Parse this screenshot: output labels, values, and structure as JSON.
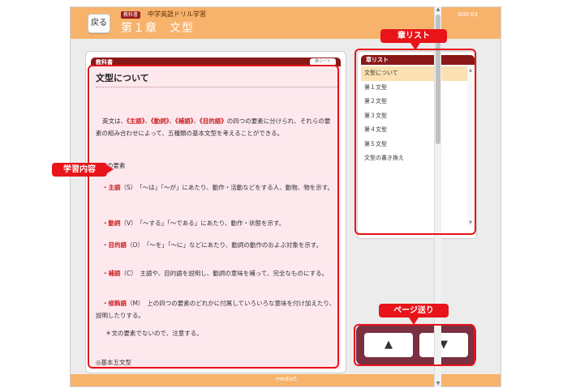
{
  "header": {
    "back_label": "戻る",
    "textbook_badge": "教科書",
    "app_name": "中学英語ドリル学習",
    "chapter_title": "第１章　文型",
    "timer": "000:03"
  },
  "textbook": {
    "panel_title": "教科書",
    "red_sheet_label": "赤シート",
    "section_title": "文型について",
    "intro_prefix": "英文は、",
    "kw_subject": "《主語》",
    "sep1": "、",
    "kw_verb": "《動詞》",
    "sep2": "、",
    "kw_complement": "《補語》",
    "sep3": "、",
    "kw_object": "《目的語》",
    "intro_suffix": "の四つの要素に分けられ、それらの要素の組み合わせによって、五種類の基本文型を考えることができる。",
    "elements_heading": "◎文の要素",
    "subject_label": "・主語",
    "subject_desc": "（S）　「～は」「～が」にあたり、動作・活動などをする人、動物、物を示す。",
    "verb_label": "・動詞",
    "verb_desc": "（V）　「～する」「～である」にあたり、動作・状態を示す。",
    "object_label": "・目的語",
    "object_desc": "（O）　「～を」「～に」などにあたり、動詞の動作のおよぶ対象を示す。",
    "complement_label": "・補語",
    "complement_desc": "（C）　主語や、目的語を説明し、動詞の意味を補って、完全なものにする。",
    "modifier_label": "・修飾語",
    "modifier_desc": "（M）　上の四つの要素のどれかに付属していろいろな意味を付け加えたり、説明したりする。",
    "note": "＊文の要素でないので、注意する。",
    "patterns_heading": "◎基本五文型"
  },
  "chapter_list": {
    "title": "章リスト",
    "items": [
      "文型について",
      "第１文型",
      "第２文型",
      "第３文型",
      "第４文型",
      "第５文型",
      "文型の書き換え"
    ]
  },
  "page_nav": {
    "up_label": "▲",
    "down_label": "▼"
  },
  "footer": {
    "label": "media5"
  },
  "annotations": {
    "chapter_list": "章リスト",
    "study_content": "学習内容",
    "page_turn": "ページ送り"
  },
  "colors": {
    "header_orange": "#f7b36b",
    "panel_header_maroon": "#8a1818",
    "annotation_red": "#e8141a",
    "content_pink": "#fde8ee",
    "active_item": "#fbe1b1",
    "page_nav_bg": "#7a3040"
  }
}
